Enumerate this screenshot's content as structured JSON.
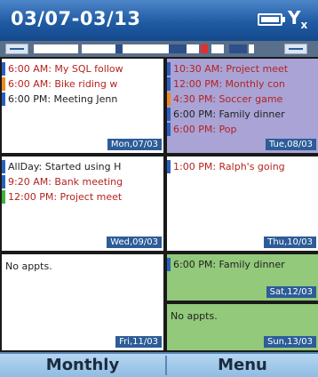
{
  "title_bar": {
    "title": "03/07-03/13",
    "battery_icon": "battery-icon",
    "signal_icon": "signal-icon",
    "signal_glyph": "Y",
    "signal_sub": "x"
  },
  "days": [
    {
      "id": "mon",
      "date_label": "Mon,07/03",
      "background": "#ffffff",
      "events": [
        {
          "text": "6:00 AM: My SQL follow",
          "color": "#b4231f",
          "bar": "#2a5fbf"
        },
        {
          "text": "6:00 AM: Bike riding w",
          "color": "#b4231f",
          "bar": "#f08a1e"
        },
        {
          "text": "6:00 PM: Meeting Jenn",
          "color": "#222222",
          "bar": "#2a5fbf"
        }
      ]
    },
    {
      "id": "tue",
      "date_label": "Tue,08/03",
      "background": "#a9a3d6",
      "events": [
        {
          "text": "10:30 AM: Project meet",
          "color": "#b4231f",
          "bar": "#2a5fbf"
        },
        {
          "text": "12:00 PM: Monthly con",
          "color": "#b4231f",
          "bar": "#2a5fbf"
        },
        {
          "text": "4:30 PM: Soccer game",
          "color": "#b4231f",
          "bar": "#f08a1e"
        },
        {
          "text": "6:00 PM: Family dinner",
          "color": "#222222",
          "bar": "#2a5fbf"
        },
        {
          "text": "6:00 PM: Pop",
          "color": "#b4231f",
          "bar": "#2a5fbf"
        }
      ]
    },
    {
      "id": "wed",
      "date_label": "Wed,09/03",
      "background": "#ffffff",
      "events": [
        {
          "text": "AllDay: Started using H",
          "color": "#222222",
          "bar": "#2a5fbf"
        },
        {
          "text": "9:20 AM: Bank meeting",
          "color": "#b4231f",
          "bar": "#2a5fbf"
        },
        {
          "text": "12:00 PM: Project meet",
          "color": "#b4231f",
          "bar": "#3fb23a"
        }
      ]
    },
    {
      "id": "thu",
      "date_label": "Thu,10/03",
      "background": "#ffffff",
      "events": [
        {
          "text": "1:00 PM: Ralph's going",
          "color": "#b4231f",
          "bar": "#2a5fbf"
        }
      ]
    },
    {
      "id": "fri",
      "date_label": "Fri,11/03",
      "background": "#ffffff",
      "no_appts": "No appts.",
      "events": []
    },
    {
      "id": "sat",
      "date_label": "Sat,12/03",
      "background": "#92c97a",
      "events": [
        {
          "text": "6:00 PM: Family dinner",
          "color": "#222222",
          "bar": "#2a5fbf"
        }
      ]
    },
    {
      "id": "sun",
      "date_label": "Sun,13/03",
      "background": "#92c97a",
      "no_appts": "No appts.",
      "events": []
    }
  ],
  "softkeys": {
    "left": "Monthly",
    "right": "Menu"
  },
  "colors": {
    "title_bar": "#1f5aa3",
    "date_tag": "#2d5c98",
    "weekend_green": "#92c97a",
    "selected_purple": "#a9a3d6",
    "softkey_bar": "#a6cdec"
  }
}
